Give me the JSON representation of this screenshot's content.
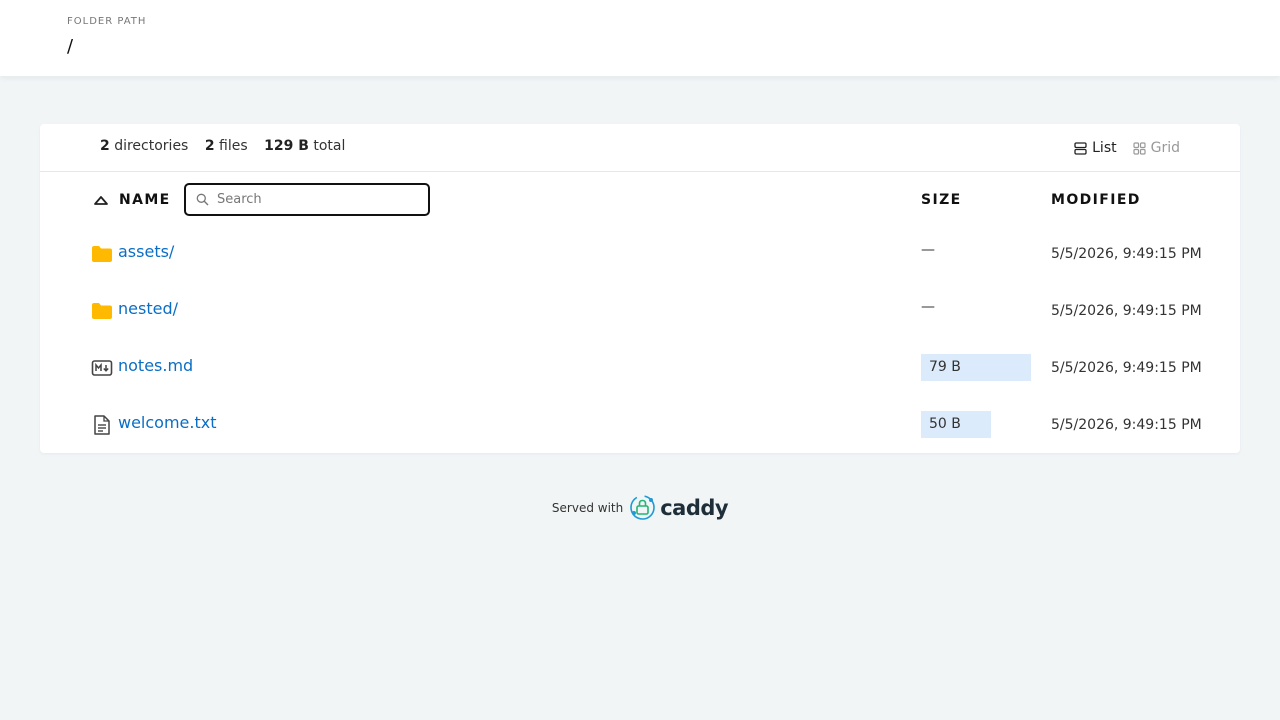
{
  "header": {
    "label": "FOLDER PATH",
    "path": "/"
  },
  "summary": {
    "dir_count": "2",
    "dir_label": "directories",
    "file_count": "2",
    "file_label": "files",
    "total_size": "129 B",
    "total_label": "total"
  },
  "view": {
    "list_label": "List",
    "grid_label": "Grid",
    "active": "List"
  },
  "columns": {
    "name": "NAME",
    "size": "SIZE",
    "modified": "MODIFIED"
  },
  "search": {
    "placeholder": "Search"
  },
  "rows": [
    {
      "name": "assets/",
      "icon": "folder-icon",
      "size": "—",
      "modified": "5/5/2026, 9:49:15 PM"
    },
    {
      "name": "nested/",
      "icon": "folder-icon",
      "size": "—",
      "modified": "5/5/2026, 9:49:15 PM"
    },
    {
      "name": "notes.md",
      "icon": "markdown-file-icon",
      "size": "79 B",
      "size_fraction": 0.61,
      "modified": "5/5/2026, 9:49:15 PM"
    },
    {
      "name": "welcome.txt",
      "icon": "text-file-icon",
      "size": "50 B",
      "size_fraction": 0.39,
      "modified": "5/5/2026, 9:49:15 PM"
    }
  ],
  "footer": {
    "served_with": "Served with",
    "brand": "caddy"
  },
  "colors": {
    "link": "#0a6ec5",
    "folder": "#ffb900",
    "size_bar": "#dcebfb",
    "background": "#f1f5f6"
  }
}
